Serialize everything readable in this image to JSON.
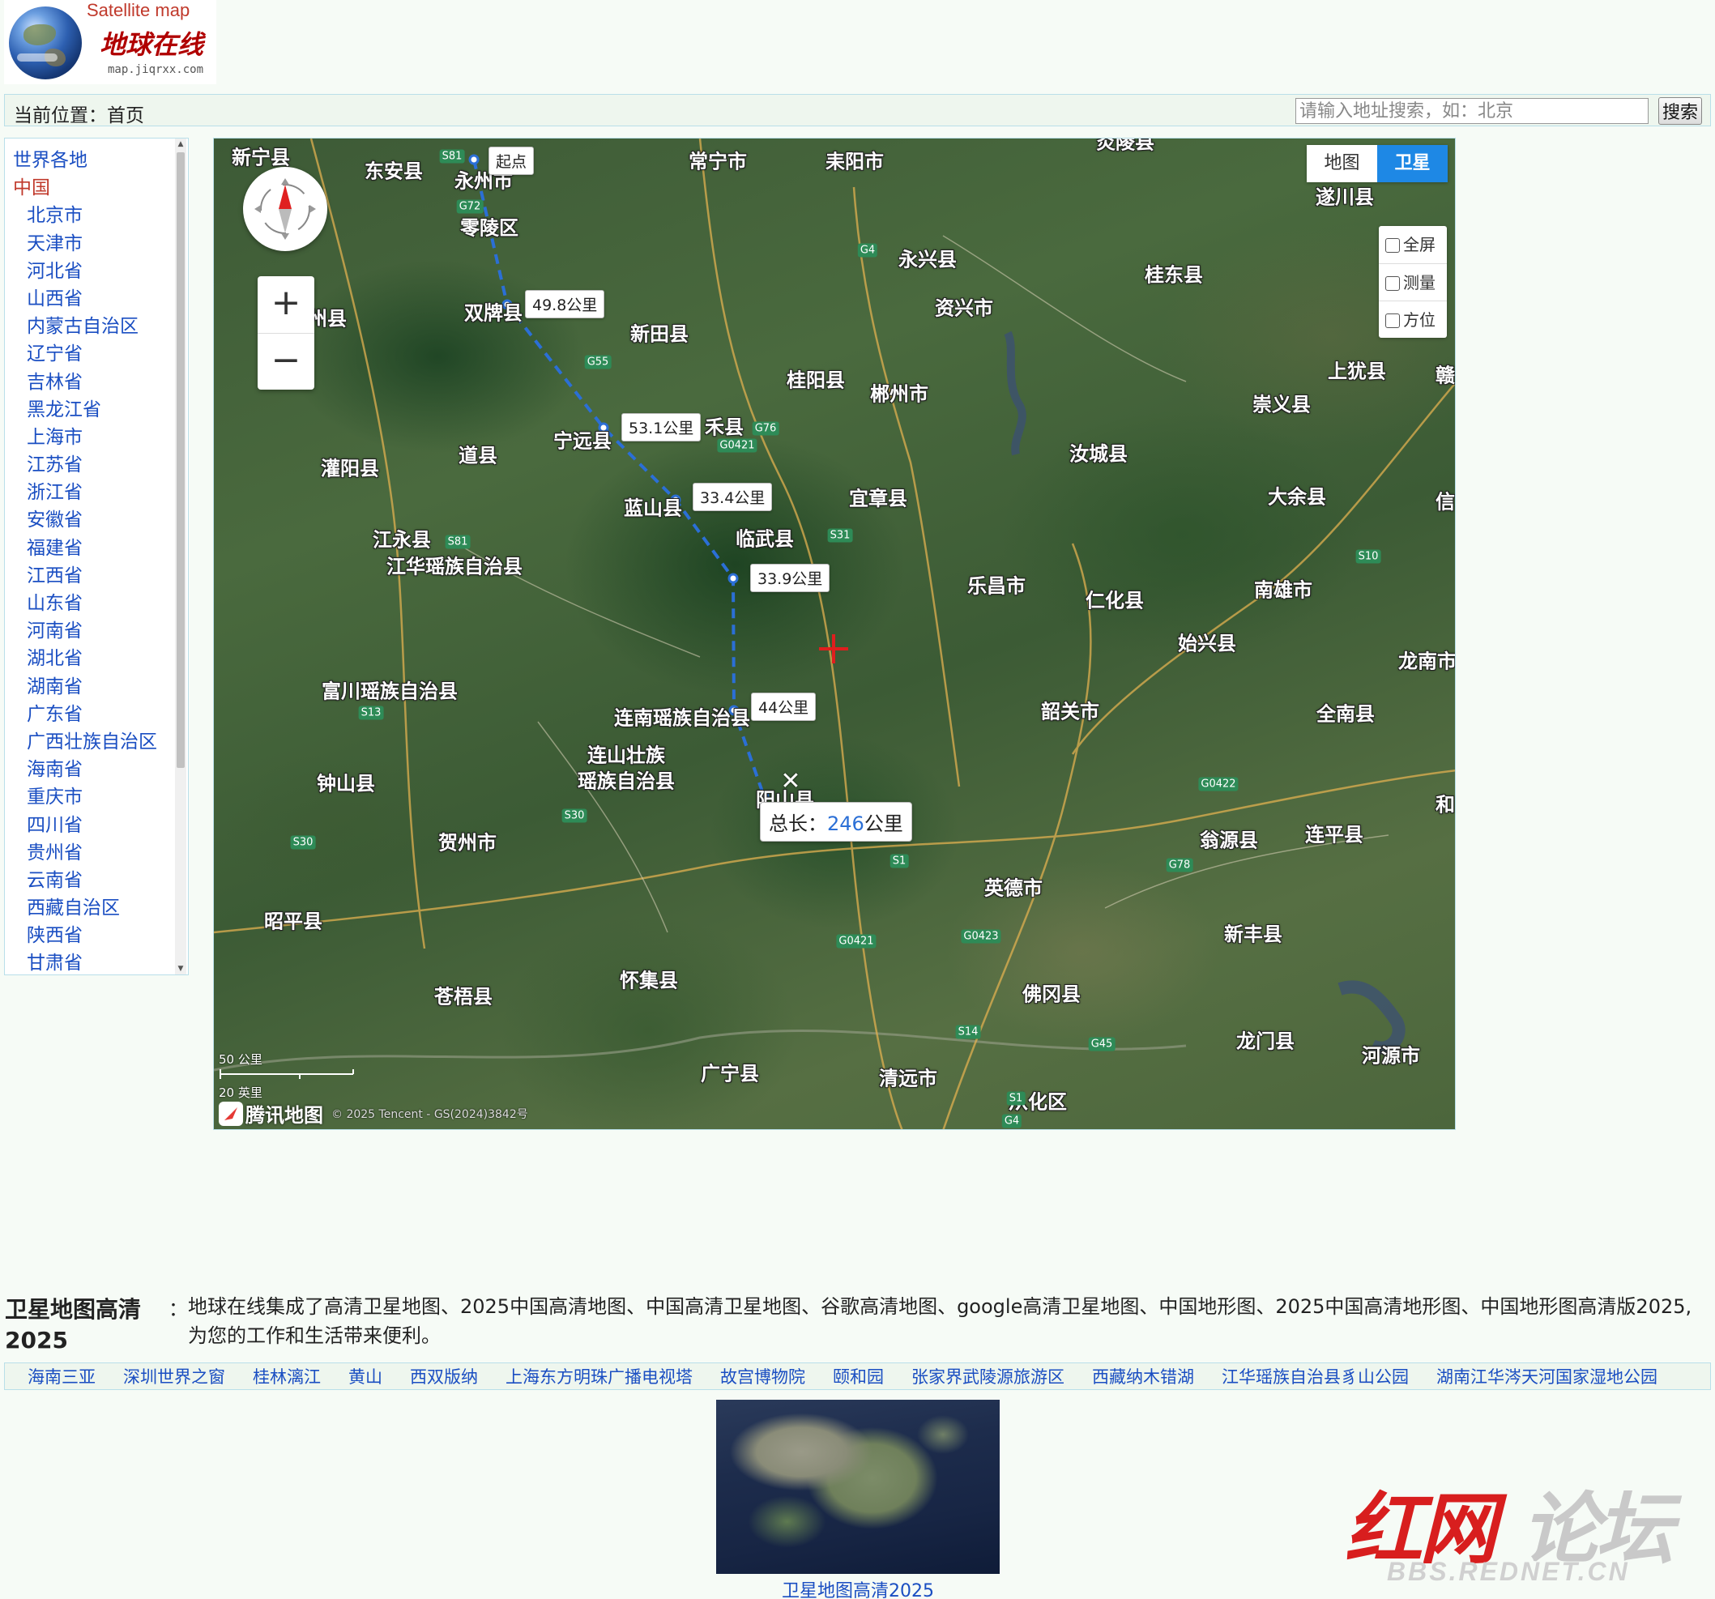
{
  "logo": {
    "title_en": "Satellite map",
    "title_cn": "地球在线",
    "url": "map.jiqrxx.com"
  },
  "breadcrumb": {
    "label": "当前位置：首页"
  },
  "search": {
    "placeholder": "请输入地址搜索，如：北京",
    "value": "",
    "button": "搜索"
  },
  "sidebar": {
    "items": [
      {
        "label": "世界各地",
        "level": 0,
        "active": false
      },
      {
        "label": "中国",
        "level": 0,
        "active": true
      },
      {
        "label": "北京市",
        "level": 1
      },
      {
        "label": "天津市",
        "level": 1
      },
      {
        "label": "河北省",
        "level": 1
      },
      {
        "label": "山西省",
        "level": 1
      },
      {
        "label": "内蒙古自治区",
        "level": 1
      },
      {
        "label": "辽宁省",
        "level": 1
      },
      {
        "label": "吉林省",
        "level": 1
      },
      {
        "label": "黑龙江省",
        "level": 1
      },
      {
        "label": "上海市",
        "level": 1
      },
      {
        "label": "江苏省",
        "level": 1
      },
      {
        "label": "浙江省",
        "level": 1
      },
      {
        "label": "安徽省",
        "level": 1
      },
      {
        "label": "福建省",
        "level": 1
      },
      {
        "label": "江西省",
        "level": 1
      },
      {
        "label": "山东省",
        "level": 1
      },
      {
        "label": "河南省",
        "level": 1
      },
      {
        "label": "湖北省",
        "level": 1
      },
      {
        "label": "湖南省",
        "level": 1
      },
      {
        "label": "广东省",
        "level": 1
      },
      {
        "label": "广西壮族自治区",
        "level": 1
      },
      {
        "label": "海南省",
        "level": 1
      },
      {
        "label": "重庆市",
        "level": 1
      },
      {
        "label": "四川省",
        "level": 1
      },
      {
        "label": "贵州省",
        "level": 1
      },
      {
        "label": "云南省",
        "level": 1
      },
      {
        "label": "西藏自治区",
        "level": 1
      },
      {
        "label": "陕西省",
        "level": 1
      },
      {
        "label": "甘肃省",
        "level": 1
      }
    ]
  },
  "map": {
    "type_buttons": [
      {
        "label": "地图",
        "selected": false
      },
      {
        "label": "卫星",
        "selected": true
      }
    ],
    "tools": [
      {
        "label": "全屏",
        "checked": false
      },
      {
        "label": "测量",
        "checked": false
      },
      {
        "label": "方位",
        "checked": false
      }
    ],
    "zoom_in": "+",
    "zoom_out": "−",
    "places": [
      "新宁县",
      "东安县",
      "永州市",
      "常宁市",
      "耒阳市",
      "炎陵县",
      "遂川县",
      "零陵区",
      "永兴县",
      "资兴市",
      "桂东县",
      "双牌县",
      "新田县",
      "桂阳县",
      "郴州市",
      "上犹县",
      "崇义县",
      "宁远县",
      "禾县",
      "道县",
      "灌阳县",
      "汝城县",
      "蓝山县",
      "宜章县",
      "大余县",
      "信",
      "临武县",
      "江永县",
      "江华瑶族自治县",
      "乐昌市",
      "仁化县",
      "南雄市",
      "始兴县",
      "龙南市",
      "富川瑶族自治县",
      "连南瑶族自治县",
      "韶关市",
      "全南县",
      "连山壮族",
      "瑶族自治县",
      "钟山县",
      "阳山县",
      "翁源县",
      "连平县",
      "贺州市",
      "英德市",
      "新丰县",
      "昭平县",
      "怀集县",
      "佛冈县",
      "苍梧县",
      "龙门县",
      "河源市",
      "广宁县",
      "清远市",
      "从化区",
      "州县",
      "赣",
      "和"
    ],
    "road_shields": [
      "S81",
      "G72",
      "G4",
      "G55",
      "G76",
      "G0421",
      "S81",
      "S31",
      "S10",
      "S13",
      "S30",
      "S30",
      "S1",
      "G0422",
      "G78",
      "G0421",
      "G0423",
      "S14",
      "G45",
      "S1",
      "G4"
    ],
    "route": {
      "start_label": "起点",
      "segments": [
        "49.8公里",
        "53.1公里",
        "33.4公里",
        "33.9公里",
        "44公里"
      ],
      "total_label": "总长：",
      "total_value": "246",
      "total_unit": "公里"
    },
    "scale": {
      "top": "50 公里",
      "bottom": "20 英里"
    },
    "brand": "腾讯地图",
    "copyright": "© 2025 Tencent - GS(2024)3842号"
  },
  "description": {
    "title": "卫星地图高清2025",
    "colon": "：",
    "text": "地球在线集成了高清卫星地图、2025中国高清地图、中国高清卫星地图、谷歌高清地图、google高清卫星地图、中国地形图、2025中国高清地形图、中国地形图高清版2025,为您的工作和生活带来便利。"
  },
  "links": [
    "海南三亚",
    "深圳世界之窗",
    "桂林漓江",
    "黄山",
    "西双版纳",
    "上海东方明珠广播电视塔",
    "故宫博物院",
    "颐和园",
    "张家界武陵源旅游区",
    "西藏纳木错湖",
    "江华瑶族自治县豸山公园",
    "湖南江华涔天河国家湿地公园"
  ],
  "thumbnail": {
    "caption": "卫星地图高清2025"
  },
  "watermark": {
    "text_red": "红网",
    "text_grey": "论坛",
    "url": "BBS.REDNET.CN"
  },
  "colors": {
    "link": "#1a4ec2",
    "active": "#c0392b",
    "accent": "#1e88e5",
    "route": "#2b6fd6"
  }
}
